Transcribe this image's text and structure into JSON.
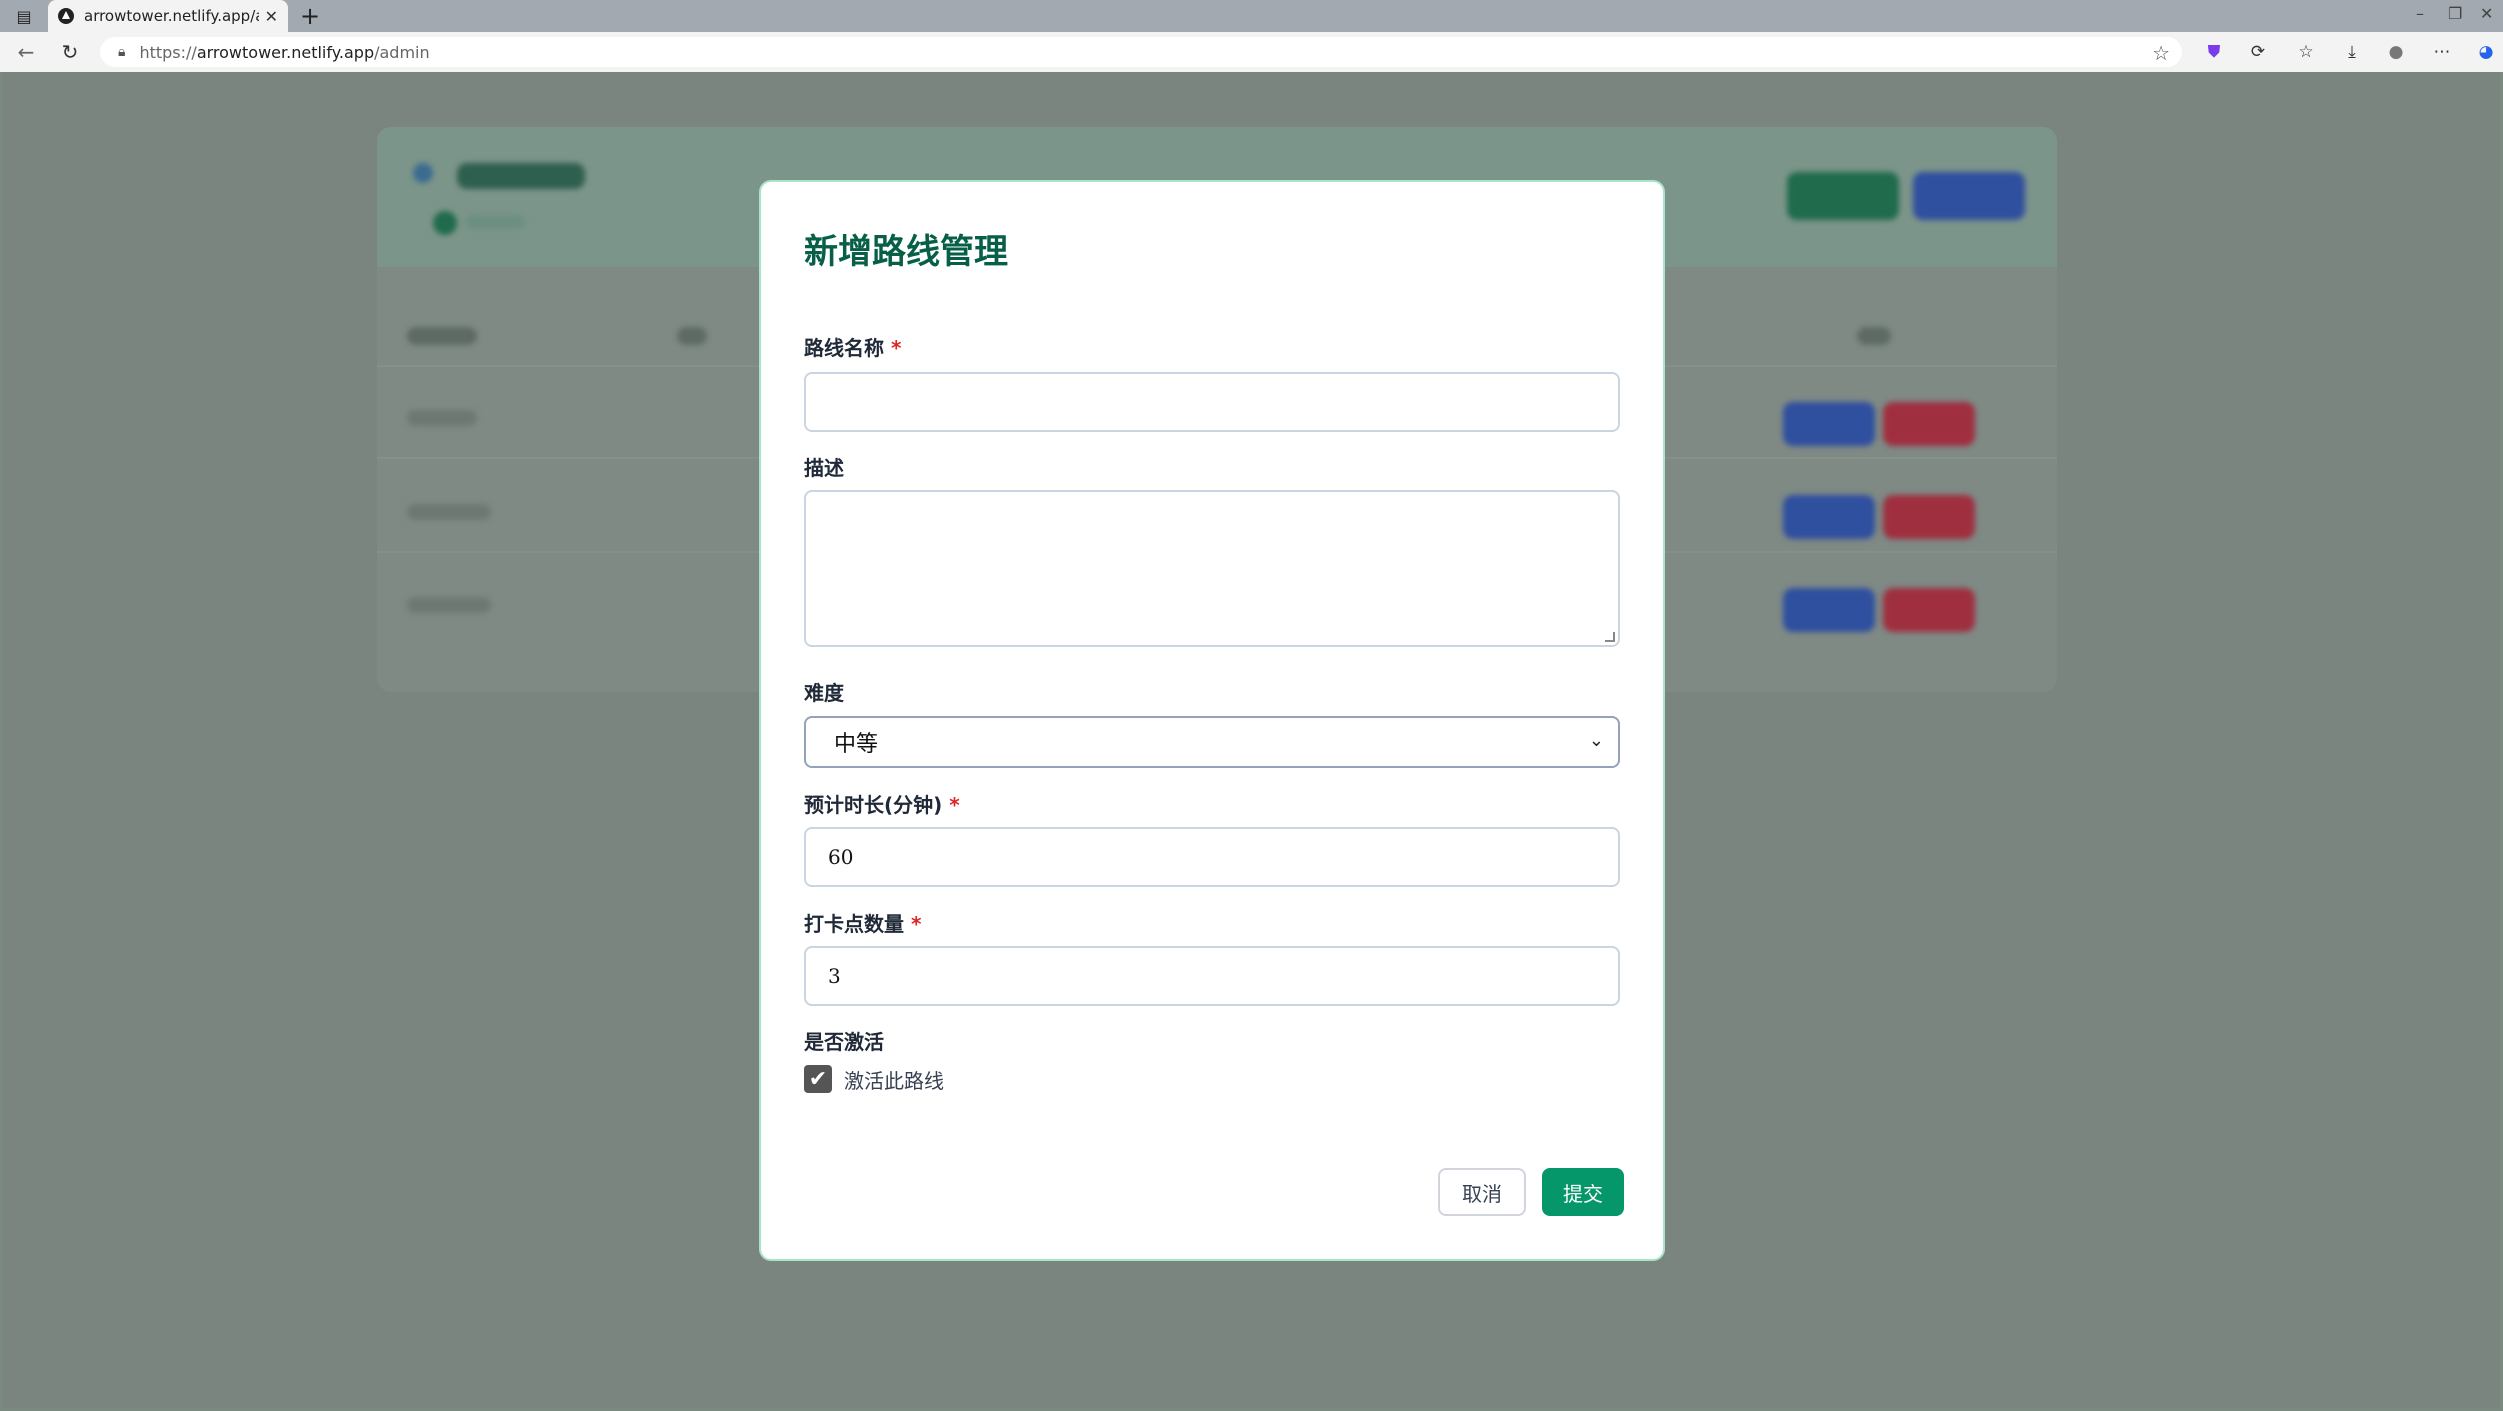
{
  "browser": {
    "tab_title": "arrowtower.netlify.app/ad",
    "url_prefix": "https://",
    "url_host": "arrowtower.netlify.app",
    "url_path": "/admin"
  },
  "modal": {
    "title": "新增路线管理",
    "fields": {
      "name": {
        "label": "路线名称",
        "required_mark": "*",
        "value": ""
      },
      "description": {
        "label": "描述",
        "value": ""
      },
      "difficulty": {
        "label": "难度",
        "value": "中等"
      },
      "duration": {
        "label": "预计时长(分钟)",
        "required_mark": "*",
        "value": "60"
      },
      "checkpoints": {
        "label": "打卡点数量",
        "required_mark": "*",
        "value": "3"
      },
      "active": {
        "label": "是否激活",
        "checkbox_label": "激活此路线",
        "checked": true
      }
    },
    "buttons": {
      "cancel": "取消",
      "submit": "提交"
    }
  },
  "colors": {
    "accent": "#059669",
    "title": "#065f46",
    "required": "#dc2626",
    "modal_border": "#a9e3c8"
  }
}
